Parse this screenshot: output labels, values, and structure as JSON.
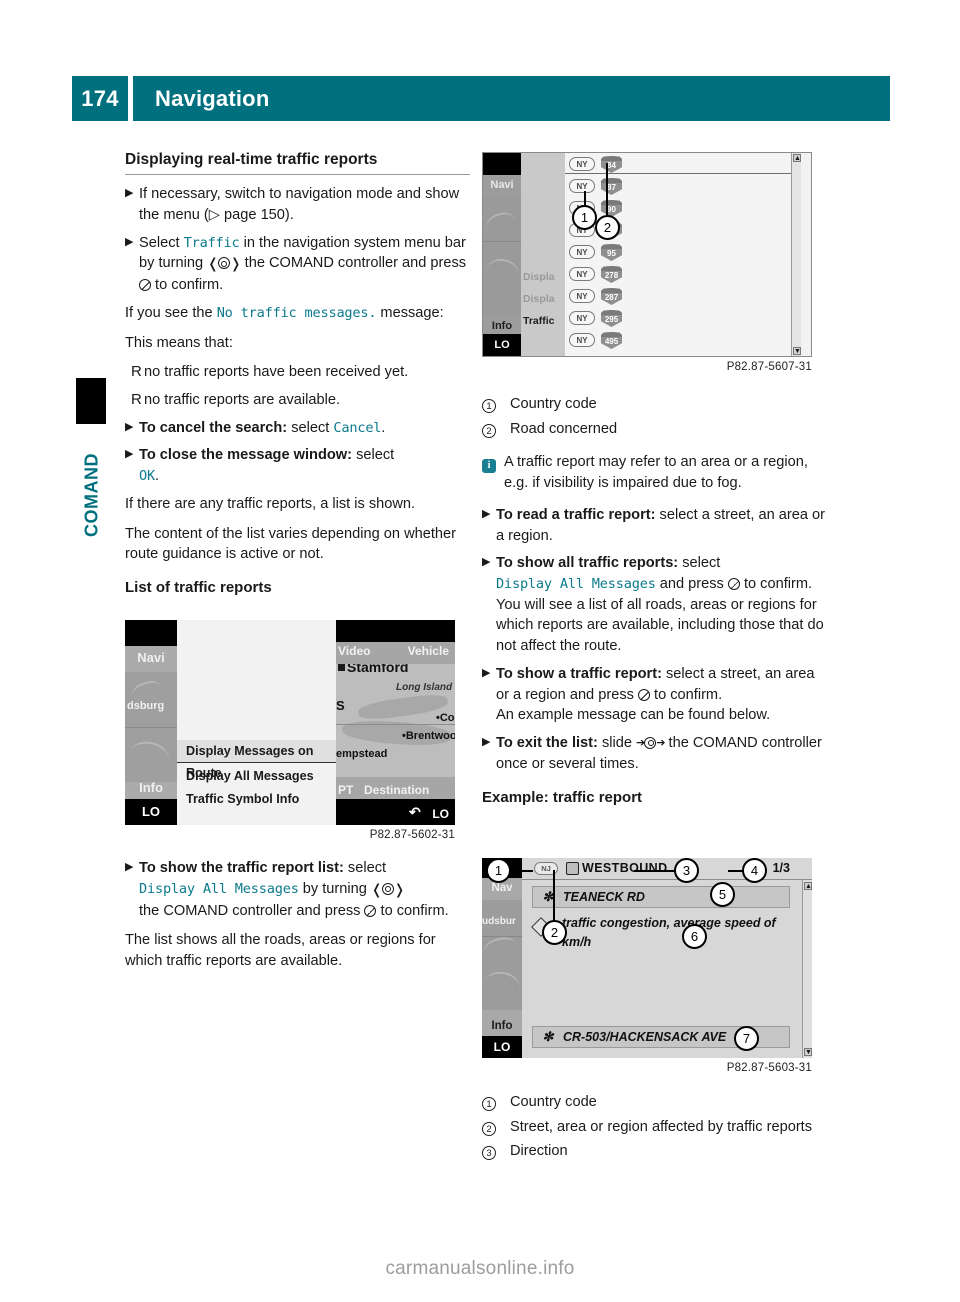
{
  "header": {
    "page_number": "174",
    "title": "Navigation"
  },
  "side_tab": {
    "label": "COMAND"
  },
  "left_column": {
    "section_title": "Displaying real-time traffic reports",
    "steps": [
      {
        "bullet": "▶",
        "parts": [
          {
            "t": "text",
            "v": "If necessary, switch to navigation mode and show the menu ("
          },
          {
            "t": "ref",
            "v": "▷ page 150"
          },
          {
            "t": "text",
            "v": ")."
          }
        ]
      },
      {
        "bullet": "▶",
        "parts": [
          {
            "t": "text",
            "v": "Select "
          },
          {
            "t": "mono",
            "v": "Traffic"
          },
          {
            "t": "text",
            "v": " in the navigation system menu bar by turning "
          },
          {
            "t": "wheel",
            "v": "❬◎❭"
          },
          {
            "t": "text",
            "v": " the COMAND controller and press "
          },
          {
            "t": "press",
            "v": "◔"
          },
          {
            "t": "text",
            "v": " to confirm."
          }
        ]
      }
    ],
    "para_ifyousee_pre": "If you see the ",
    "para_ifyousee_mono": "No traffic messages.",
    "para_ifyousee_post": " message:",
    "para_means": "This means that:",
    "bullets": [
      "no traffic reports have been received yet.",
      "no traffic reports are available."
    ],
    "step_cancel_bold": "To cancel the search:",
    "step_cancel_text": " select ",
    "step_cancel_mono": "Cancel",
    "step_cancel_tail": ".",
    "step_close_bold": "To close the message window:",
    "step_close_text": " select ",
    "step_close_mono": "OK",
    "step_close_tail": ".",
    "para_list_shown": "If there are any traffic reports, a list is shown.",
    "para_content_varies": "The content of the list varies depending on whether route guidance is active or not.",
    "subsection_title": "List of traffic reports",
    "step_show_list_bold": "To show the traffic report list:",
    "step_show_list_text1": " select ",
    "step_show_list_mono": "Display All Messages",
    "step_show_list_text2": " by turning ",
    "step_show_list_text3": " the COMAND controller and press ",
    "step_show_list_text4": " to confirm.",
    "para_list_shows": "The list shows all the roads, areas or regions for which traffic reports are available."
  },
  "right_column": {
    "legend_top": [
      {
        "num": "1",
        "label": "Country code"
      },
      {
        "num": "2",
        "label": "Road concerned"
      }
    ],
    "note": "A traffic report may refer to an area or a region, e.g. if visibility is impaired due to fog.",
    "step_read_bold": "To read a traffic report:",
    "step_read_text": " select a street, an area or a region.",
    "step_showall_bold": "To show all traffic reports:",
    "step_showall_text1": " select ",
    "step_showall_mono": "Display All Messages",
    "step_showall_text2": " and press ",
    "step_showall_text3": " to confirm.",
    "step_showall_extra": "You will see a list of all roads, areas or regions for which reports are available, including those that do not affect the route.",
    "step_showone_bold": "To show a traffic report:",
    "step_showone_text1": " select a street, an area or a region and press ",
    "step_showone_text2": " to confirm.",
    "step_showone_extra": "An example message can be found below.",
    "step_exit_bold": "To exit the list:",
    "step_exit_text1": " slide ",
    "step_exit_text2": " the COMAND controller once or several times.",
    "subsection_title": "Example: traffic report",
    "legend_bottom": [
      {
        "num": "1",
        "label": "Country code"
      },
      {
        "num": "2",
        "label": "Street, area or region affected by traffic reports"
      },
      {
        "num": "3",
        "label": "Direction"
      }
    ]
  },
  "figure_traffic_list": {
    "caption": "P82.87-5607-31",
    "nav_labels": [
      "Navi",
      "Info",
      "LO"
    ],
    "dim_menu_items": [
      "Displa",
      "Displa",
      "Traffic"
    ],
    "rows": [
      {
        "country": "NY",
        "shield": "84"
      },
      {
        "country": "NY",
        "shield": "87"
      },
      {
        "country": "NY",
        "shield": "90"
      },
      {
        "country": "NY",
        "shield": ""
      },
      {
        "country": "NY",
        "shield": "95"
      },
      {
        "country": "NY",
        "shield": "278"
      },
      {
        "country": "NY",
        "shield": "287"
      },
      {
        "country": "NY",
        "shield": "295"
      },
      {
        "country": "NY",
        "shield": "495"
      }
    ],
    "callouts": [
      "1",
      "2"
    ],
    "scroll_up": "▲",
    "scroll_down": "▼"
  },
  "figure_menu": {
    "caption": "P82.87-5602-31",
    "rail_labels": [
      "Navi",
      "Info",
      "LO"
    ],
    "map_label_left": "dsburg",
    "menu_items": [
      "Display Messages on Route",
      "Display All Messages",
      "Traffic Symbol Info"
    ],
    "map_top_bar": [
      "Video",
      "Vehicle"
    ],
    "map_bottom_bar": [
      "PT",
      "Destination"
    ],
    "map_status_right": "LO",
    "map_places": [
      "Stamford",
      "Long Island",
      "S",
      "Cor.",
      "Brentwood",
      "empstead"
    ]
  },
  "figure_example": {
    "caption": "P82.87-5603-31",
    "rail_labels": [
      "Nav",
      "udsbur",
      "Info",
      "LO"
    ],
    "country_badge": "NJ",
    "direction_title": "WESTBOUND",
    "page_indicator": "1/3",
    "street_top": "TEANECK RD",
    "message_line1": "traffic congestion, average speed of",
    "message_line2": "km/h",
    "street_bottom": "CR-503/HACKENSACK AVE",
    "callouts": [
      "1",
      "2",
      "3",
      "4",
      "5",
      "6",
      "7"
    ],
    "scroll_up": "▲",
    "scroll_down": "▼"
  },
  "watermark": {
    "text": "carmanualsonline.info"
  },
  "colors": {
    "accent_teal": "#00707f",
    "mono_teal": "#0b7a8c",
    "info_icon": "#1a7f93"
  }
}
